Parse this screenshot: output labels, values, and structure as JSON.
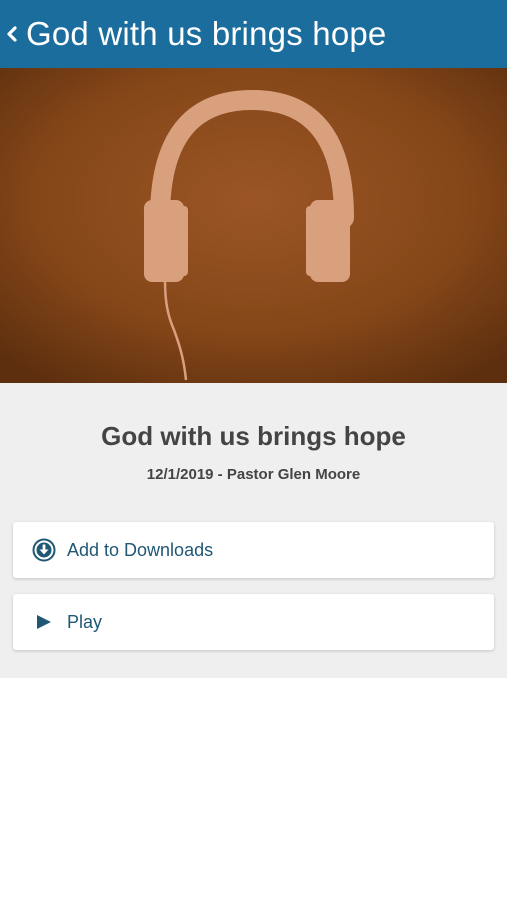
{
  "header": {
    "title": "God with us brings hope",
    "background_color": "#1a6d9c",
    "back_icon": "chevron-left-icon"
  },
  "artwork": {
    "subject": "headphones-illustration",
    "background_color": "#8a4a1f",
    "foreground_color": "#d9a07e"
  },
  "sermon": {
    "title": "God with us brings hope",
    "meta": "12/1/2019 - Pastor Glen Moore"
  },
  "actions": {
    "download": {
      "label": "Add to Downloads",
      "icon": "download-circle-icon"
    },
    "play": {
      "label": "Play",
      "icon": "play-icon"
    },
    "accent_color": "#1f5775"
  }
}
